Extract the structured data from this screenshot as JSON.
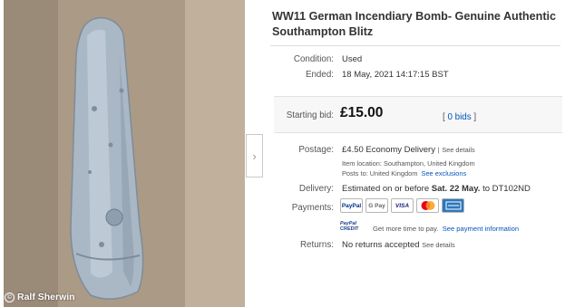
{
  "listing": {
    "title": "WW11 German Incendiary Bomb- Genuine Authentic Southampton Blitz",
    "condition_label": "Condition:",
    "condition_value": "Used",
    "ended_label": "Ended:",
    "ended_value": "18 May, 2021  14:17:15 BST",
    "starting_bid_label": "Starting bid:",
    "starting_bid_value": "£15.00",
    "bids_open": "[",
    "bids_link": "0 bids",
    "bids_close": "]",
    "postage_label": "Postage:",
    "postage_price": "£4.50",
    "postage_service": "Economy Delivery",
    "postage_sep": "|",
    "see_details": "See details",
    "item_location": "Item location:  Southampton, United Kingdom",
    "posts_to": "Posts to:  United Kingdom",
    "see_exclusions": "See exclusions",
    "delivery_label": "Delivery:",
    "delivery_prefix": "Estimated on or before",
    "delivery_date": "Sat. 22 May.",
    "delivery_suffix": "to DT102ND",
    "payments_label": "Payments:",
    "payment_logos": [
      "PayPal",
      "G Pay",
      "VISA",
      "MC",
      "AMEX"
    ],
    "credit_line1": "PayPal",
    "credit_line2": "CREDIT",
    "credit_text": "Get more time to pay.",
    "see_payment_info": "See payment information",
    "returns_label": "Returns:",
    "returns_value": "No returns accepted",
    "see_details_returns": "See details"
  },
  "photo": {
    "credit": "Ralf Sherwin",
    "next_arrow": "›",
    "cc_mark": "©"
  },
  "colors": {
    "link": "#0654ba",
    "mastercard_red": "#eb001b",
    "mastercard_yellow": "#f79e1b",
    "visa_blue": "#1a1f71",
    "amex_blue": "#2e77bc"
  }
}
